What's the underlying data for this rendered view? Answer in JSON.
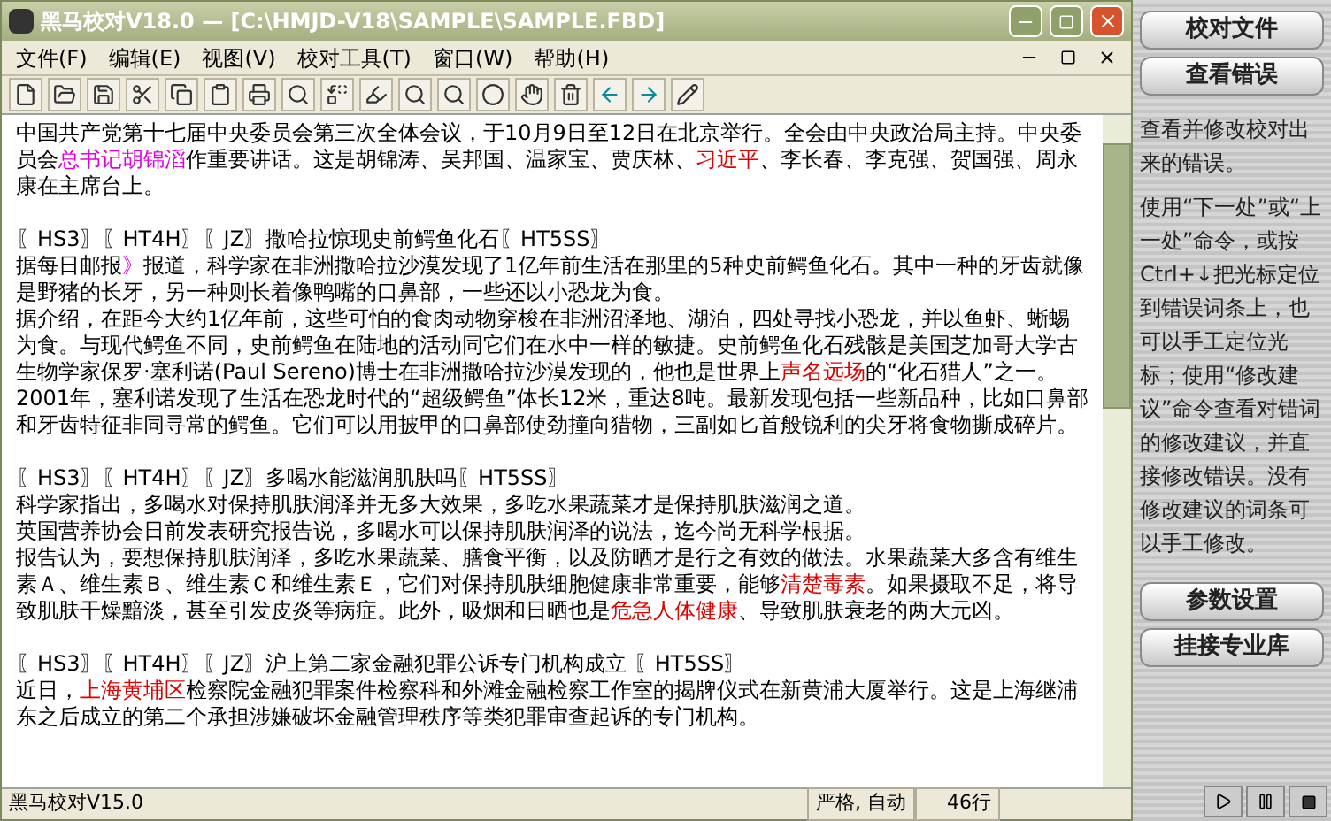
{
  "window": {
    "title": "黑马校对V18.0 — [C:\\HMJD-V18\\SAMPLE\\SAMPLE.FBD]"
  },
  "menu": [
    "文件(F)",
    "编辑(E)",
    "视图(V)",
    "校对工具(T)",
    "窗口(W)",
    "帮助(H)"
  ],
  "document": [
    {
      "paragraphs": [
        [
          {
            "kind": "plain",
            "text": "中国共产党第十七届中央委员会第三次全体会议，于10月9日至12日在北京举行。全会由中央政治局主持。中央委员会"
          },
          {
            "kind": "warning",
            "text": "总书记胡锦滔"
          },
          {
            "kind": "plain",
            "text": "作重要讲话。这是胡锦涛、吴邦国、温家宝、贾庆林、"
          },
          {
            "kind": "error",
            "text": "习近平"
          },
          {
            "kind": "plain",
            "text": "、李长春、李克强、贺国强、周永康在主席台上。"
          }
        ]
      ]
    },
    {
      "heading": "〖HS3〗〖HT4H〗〖JZ〗撒哈拉惊现史前鳄鱼化石〖HT5SS〗",
      "paragraphs": [
        [
          {
            "kind": "plain",
            "text": "据每日邮报"
          },
          {
            "kind": "warning",
            "text": "》"
          },
          {
            "kind": "plain",
            "text": "报道，科学家在非洲撒哈拉沙漠发现了1亿年前生活在那里的5种史前鳄鱼化石。其中一种的牙齿就像是野猪的长牙，另一种则长着像鸭嘴的口鼻部，一些还以小恐龙为食。"
          }
        ],
        [
          {
            "kind": "plain",
            "text": "据介绍，在距今大约1亿年前，这些可怕的食肉动物穿梭在非洲沼泽地、湖泊，四处寻找小恐龙，并以鱼虾、蜥蜴为食。与现代鳄鱼不同，史前鳄鱼在陆地的活动同它们在水中一样的敏捷。史前鳄鱼化石残骸是美国芝加哥大学古生物学家保罗·塞利诺(Paul Sereno)博士在非洲撒哈拉沙漠发现的，他也是世界上"
          },
          {
            "kind": "error",
            "text": "声名远场"
          },
          {
            "kind": "plain",
            "text": "的“化石猎人”之一。2001年，塞利诺发现了生活在恐龙时代的“超级鳄鱼”体长12米，重达8吨。最新发现包括一些新品种，比如口鼻部和牙齿特征非同寻常的鳄鱼。它们可以用披甲的口鼻部使劲撞向猎物，三副如匕首般锐利的尖牙将食物撕成碎片。"
          }
        ]
      ]
    },
    {
      "heading": "〖HS3〗〖HT4H〗〖JZ〗多喝水能滋润肌肤吗〖HT5SS〗",
      "paragraphs": [
        [
          {
            "kind": "plain",
            "text": "科学家指出，多喝水对保持肌肤润泽并无多大效果，多吃水果蔬菜才是保持肌肤滋润之道。"
          }
        ],
        [
          {
            "kind": "plain",
            "text": "英国营养协会日前发表研究报告说，多喝水可以保持肌肤润泽的说法，迄今尚无科学根据。"
          }
        ],
        [
          {
            "kind": "plain",
            "text": "报告认为，要想保持肌肤润泽，多吃水果蔬菜、膳食平衡，以及防晒才是行之有效的做法。水果蔬菜大多含有维生素Ａ、维生素Ｂ、维生素Ｃ和维生素Ｅ，它们对保持肌肤细胞健康非常重要，能够"
          },
          {
            "kind": "error",
            "text": "清楚毒素"
          },
          {
            "kind": "plain",
            "text": "。如果摄取不足，将导致肌肤干燥黯淡，甚至引发皮炎等病症。此外，吸烟和日晒也是"
          },
          {
            "kind": "error",
            "text": "危急人体健康"
          },
          {
            "kind": "plain",
            "text": "、导致肌肤衰老的两大元凶。"
          }
        ]
      ]
    },
    {
      "heading": "〖HS3〗〖HT4H〗〖JZ〗沪上第二家金融犯罪公诉专门机构成立 〖HT5SS〗",
      "paragraphs": [
        [
          {
            "kind": "plain",
            "text": "近日，"
          },
          {
            "kind": "error",
            "text": "上海黄埔区"
          },
          {
            "kind": "plain",
            "text": "检察院金融犯罪案件检察科和外滩金融检察工作室的揭牌仪式在新黄浦大厦举行。这是上海继浦东之后成立的第二个承担涉嫌破坏金融管理秩序等类犯罪审查起诉的专门机构。"
          }
        ]
      ]
    }
  ],
  "status_bar": {
    "app": "黑马校对V15.0",
    "mode": "严格, 自动",
    "lines": "46行"
  },
  "side_panel": {
    "top_buttons": [
      "校对文件",
      "查看错误"
    ],
    "help": [
      "查看并修改校对出来的错误。",
      "使用“下一处”或“上一处”命令，或按Ctrl+↓把光标定位到错误词条上，也可以手工定位光标；使用“修改建议”命令查看对错词的修改建议，并直接修改错误。没有修改建议的词条可以手工修改。"
    ],
    "bottom_buttons": [
      "参数设置",
      "挂接专业库"
    ]
  }
}
